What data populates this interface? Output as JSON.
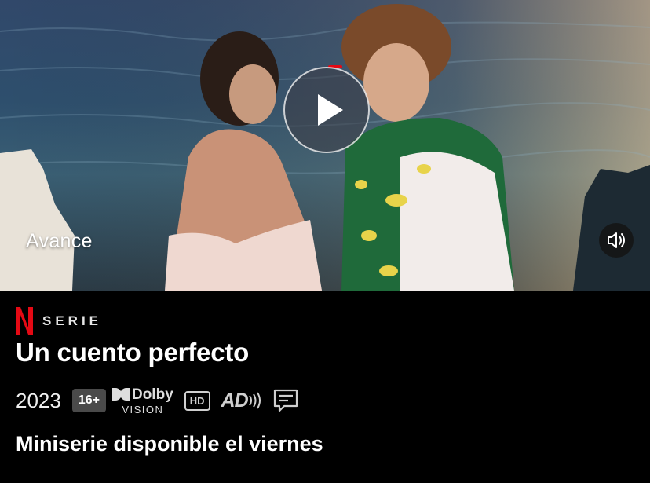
{
  "hero": {
    "preview_label": "Avance",
    "play_icon": "play-icon",
    "sound_icon": "speaker-icon"
  },
  "info": {
    "brand_letter": "N",
    "type_label": "SERIE",
    "title": "Un cuento perfecto",
    "year": "2023",
    "age_rating": "16+",
    "dolby_brand": "Dolby",
    "dolby_sub": "VISION",
    "hd_label": "HD",
    "ad_label": "AD",
    "availability": "Miniserie disponible el viernes"
  },
  "colors": {
    "brand_red": "#e50914",
    "background": "#000000",
    "rating_bg": "#4a4a4a"
  }
}
